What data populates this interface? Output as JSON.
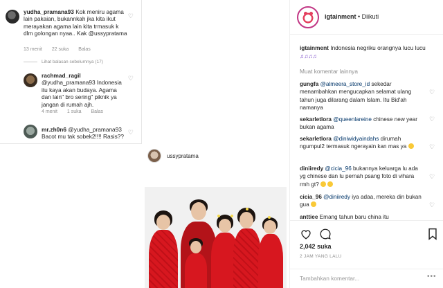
{
  "left": {
    "comments": [
      {
        "username": "yudha_pramana93",
        "text": "Kok meniru agama lain pakaian, bukannkah jka kita ikut merayakan agama lain kita trmasuk k dlm golongan nyaa.. Kak @ussypratama",
        "time": "13 menit",
        "likes": "22 suka",
        "reply": "Balas"
      },
      {
        "username": "rachmad_ragil",
        "text": "@yudha_pramana93 Indonesia itu kaya akan budaya. Agama dan lain\" bro sering\" piknik ya jangan di rumah ajh.",
        "time": "4 menit",
        "likes": "1 suka",
        "reply": "Balas"
      },
      {
        "username": "mr.zh0n6",
        "text": "@yudha_pramana93 Bacot mu tak sobek2!!!! Rasis??",
        "time": "",
        "likes": "",
        "reply": ""
      }
    ],
    "view_replies": "Lihat balasan sebelumnya (17)"
  },
  "middle": {
    "post_user": "ussypratama"
  },
  "right": {
    "header": {
      "username": "igtainment",
      "separator": " • ",
      "follow_status": "Diikuti"
    },
    "caption": {
      "username": "igtainment",
      "text": "Indonesia negriku orangnya lucu lucu",
      "emoji": "♫♫♫♫"
    },
    "load_more": "Muat komentar lainnya",
    "comments": [
      {
        "username": "gungfa",
        "mention": "@almeera_store_id",
        "text": "sekedar menambahkan mengucapkan selamat ulang tahun juga dilarang dalam Islam. Itu Bid'ah namanya"
      },
      {
        "username": "sekarletlora",
        "mention": "@queenlareine",
        "text": "chinese new year bukan agama"
      },
      {
        "username": "sekarletlora",
        "mention": "@diniwidyaindahs",
        "text": "dirumah ngumpul2 termasuk ngerayain kan mas ya"
      },
      {
        "username": "diniiredy",
        "mention": "@cicia_96",
        "text": "bukannya keluarga lu ada yg chinese dan lu pernah psang foto di vihara rmh gt?"
      },
      {
        "username": "cicia_96",
        "mention": "@diniiredy",
        "text": "iya adaa, mereka din bukan gua"
      },
      {
        "username": "anttiee",
        "mention": "",
        "text": "Emang tahun baru china itu"
      }
    ],
    "likes": "2,042 suka",
    "time": "2 JAM YANG LALU",
    "add_comment_placeholder": "Tambahkan komentar...",
    "more_label": "•••"
  }
}
